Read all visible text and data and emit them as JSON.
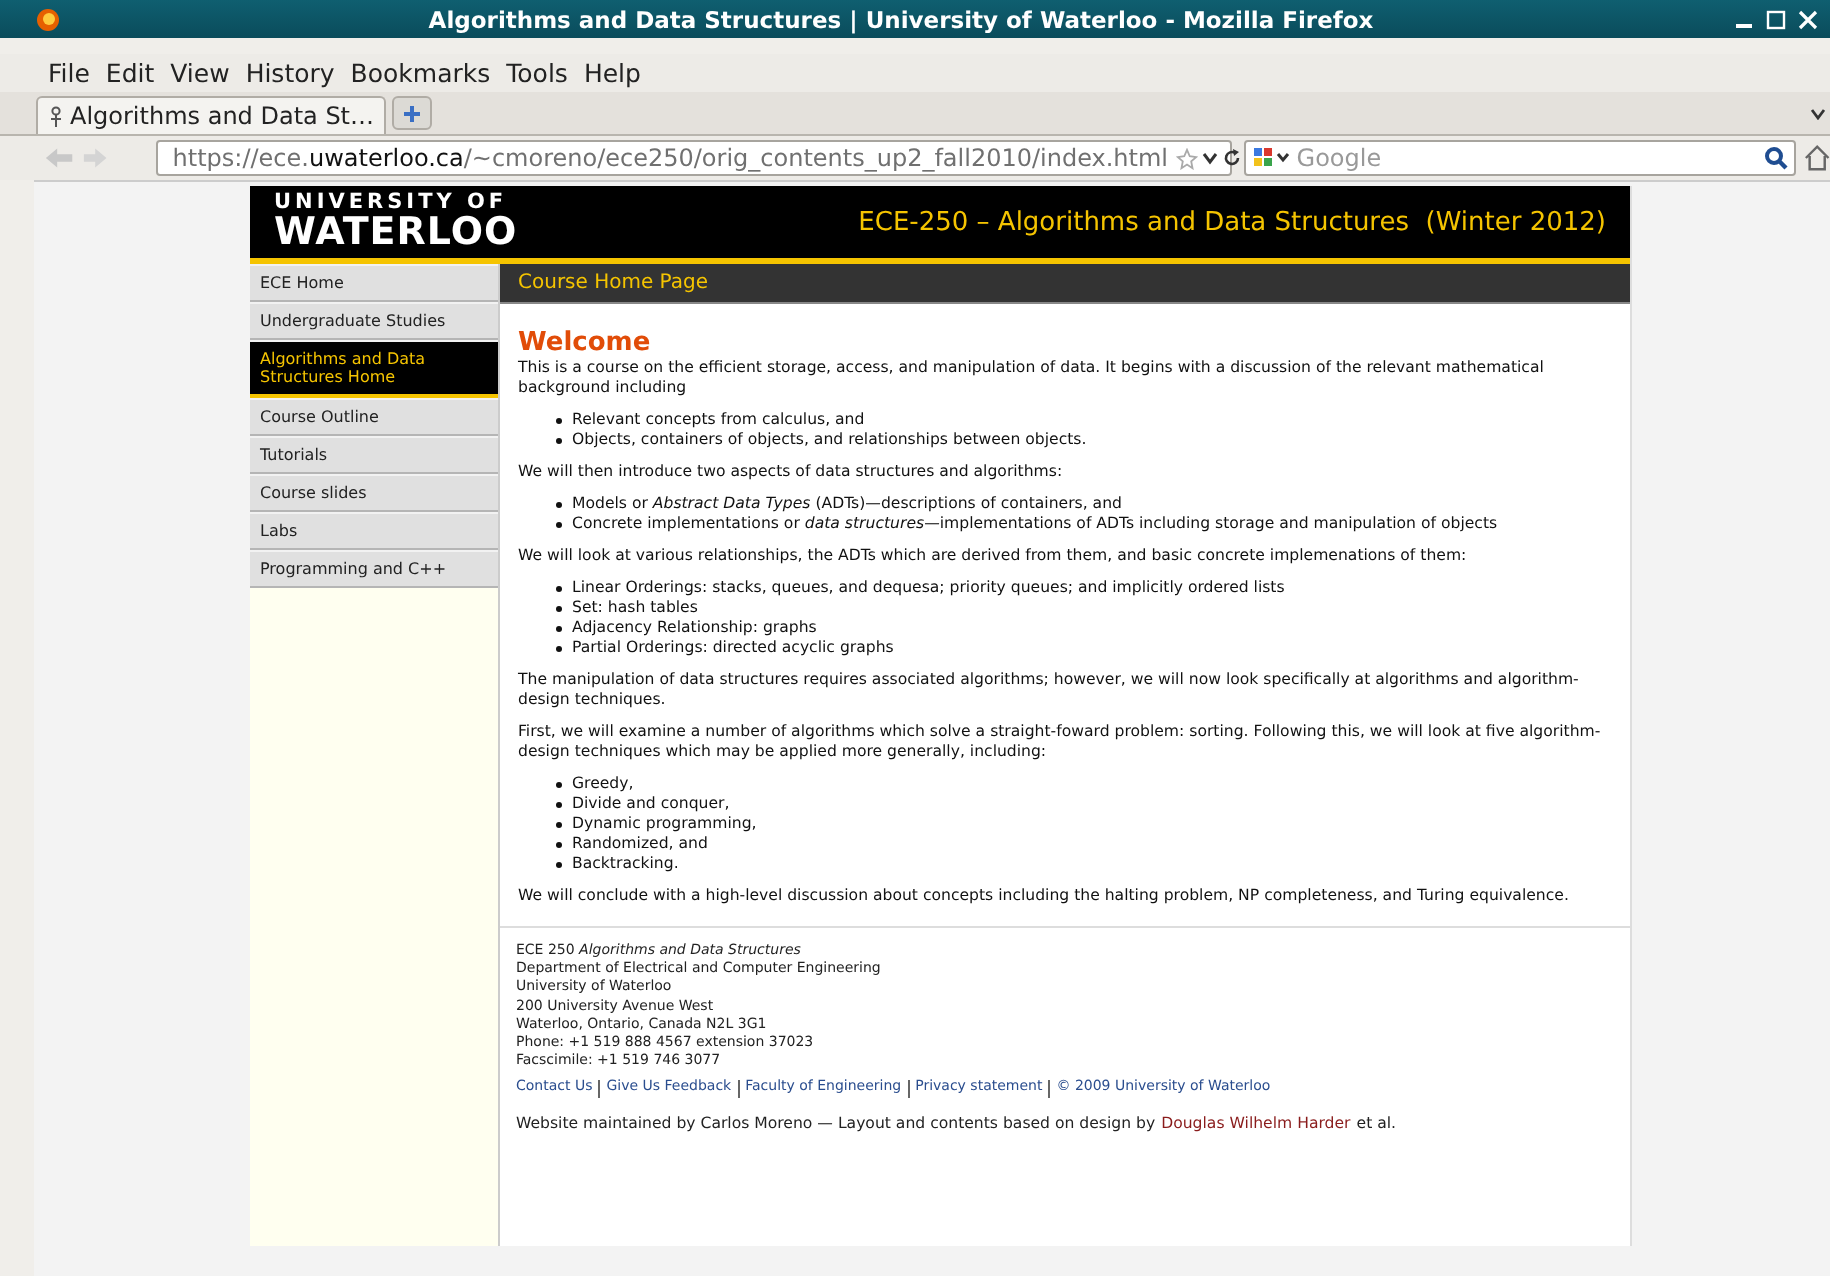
{
  "window": {
    "title": "Algorithms and Data Structures | University of Waterloo - Mozilla Firefox"
  },
  "menu": [
    "File",
    "Edit",
    "View",
    "History",
    "Bookmarks",
    "Tools",
    "Help"
  ],
  "tabs": [
    {
      "label": "Algorithms and Data St…",
      "selected": true
    }
  ],
  "address": {
    "prefix": "https://ece.",
    "domain": "uwaterloo.ca",
    "path": "/~cmoreno/ece250/orig_contents_up2_fall2010/index.html"
  },
  "search": {
    "placeholder": "Google"
  },
  "site": {
    "logo_top": "UNIVERSITY OF",
    "logo_main": "WATERLOO",
    "course_title": "ECE-250 – Algorithms and Data Structures  (Winter 2012)",
    "page_heading": "Course Home Page"
  },
  "sidebar": {
    "items": [
      {
        "label": "ECE Home",
        "selected": false
      },
      {
        "label": "Undergraduate Studies",
        "selected": false
      },
      {
        "label": "Algorithms and Data Structures Home",
        "selected": true
      },
      {
        "label": "Course Outline",
        "selected": false
      },
      {
        "label": "Tutorials",
        "selected": false
      },
      {
        "label": "Course slides",
        "selected": false
      },
      {
        "label": "Labs",
        "selected": false
      },
      {
        "label": "Programming and C++",
        "selected": false
      }
    ]
  },
  "content": {
    "heading": "Welcome",
    "blocks": [
      {
        "kind": "paragraph",
        "text": "This is a course on the efficient storage, access, and manipulation of data. It begins with a discussion of the relevant mathematical background including"
      },
      {
        "kind": "list",
        "items": [
          "Relevant concepts from calculus, and",
          "Objects, containers of objects, and relationships between objects."
        ]
      },
      {
        "kind": "paragraph",
        "text": "We will then introduce two aspects of data structures and algorithms:"
      },
      {
        "kind": "list",
        "items": [
          "Models or *Abstract Data Types* (ADTs)—descriptions of containers, and",
          "Concrete implementations or *data structures*—implementations of ADTs including storage and manipulation of objects"
        ]
      },
      {
        "kind": "paragraph",
        "text": "We will look at various relationships, the ADTs which are derived from them, and basic concrete implemenations of them:"
      },
      {
        "kind": "list",
        "items": [
          "Linear Orderings: stacks, queues, and dequesa; priority queues; and implicitly ordered lists",
          "Set: hash tables",
          "Adjacency Relationship: graphs",
          "Partial Orderings: directed acyclic graphs"
        ]
      },
      {
        "kind": "paragraph",
        "text": "The manipulation of data structures requires associated algorithms; however, we will now look specifically at algorithms and algorithm-design techniques."
      },
      {
        "kind": "paragraph",
        "text": "First, we will examine a number of algorithms which solve a straight-foward problem: sorting. Following this, we will look at five algorithm-design techniques which may be applied more generally, including:"
      },
      {
        "kind": "list",
        "items": [
          "Greedy,",
          "Divide and conquer,",
          "Dynamic programming,",
          "Randomized, and",
          "Backtracking."
        ]
      },
      {
        "kind": "paragraph",
        "text": "We will conclude with a high-level discussion about concepts including the halting problem, NP completeness, and Turing equivalence."
      }
    ]
  },
  "footer": {
    "address_lines": [
      "ECE 250 *Algorithms and Data Structures*",
      "Department of Electrical and Computer Engineering",
      "University of Waterloo",
      "200 University Avenue West",
      "Waterloo, Ontario, Canada N2L 3G1",
      "Phone: +1 519 888 4567 extension 37023",
      "Facscimile: +1 519 746 3077"
    ],
    "links": [
      "Contact Us",
      "Give Us Feedback",
      "Faculty of Engineering",
      "Privacy statement",
      "© 2009 University of Waterloo"
    ],
    "maintained_text": "Website maintained by Carlos Moreno — Layout and contents based on design by",
    "maintained_link": "Douglas Wilhelm Harder",
    "maintained_tail": "et al."
  }
}
